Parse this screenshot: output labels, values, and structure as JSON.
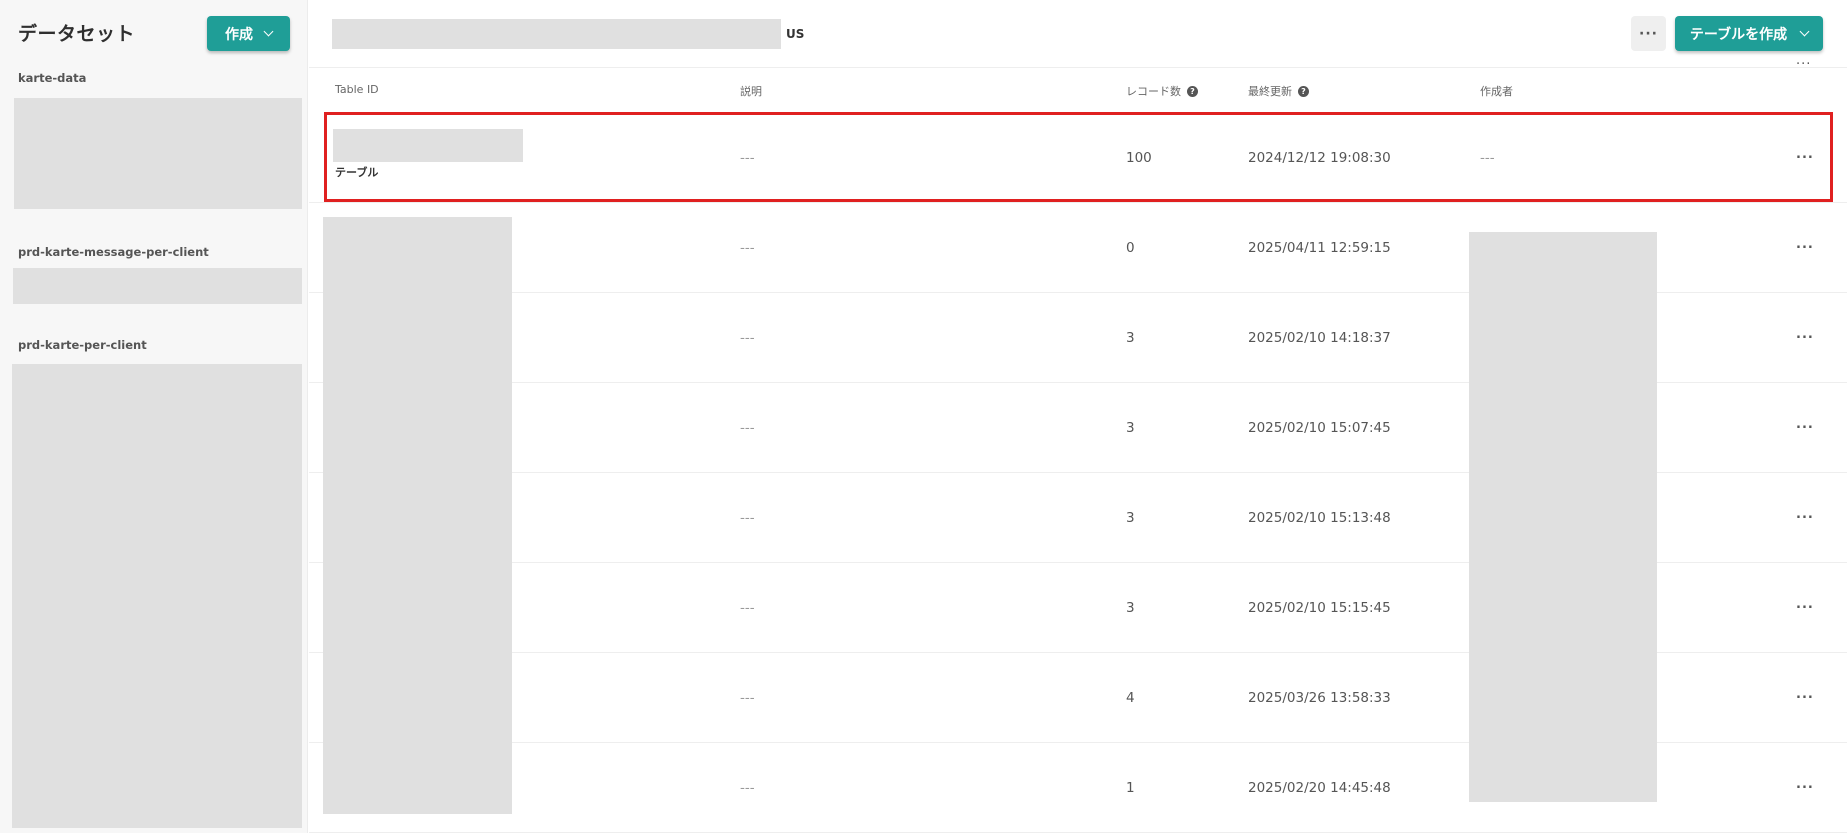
{
  "sidebar": {
    "title": "データセット",
    "create_label": "作成",
    "datasets": [
      "karte-data",
      "prd-karte-message-per-client",
      "prd-karte-per-client"
    ]
  },
  "topbar": {
    "region": "US",
    "more_label": "···",
    "create_table_label": "テーブルを作成"
  },
  "table": {
    "headers": {
      "table_id": "Table ID",
      "description": "説明",
      "record_count": "レコード数",
      "last_updated": "最終更新",
      "creator": "作成者"
    },
    "rows": [
      {
        "name": "テーブル",
        "description": "---",
        "count": "100",
        "updated": "2024/12/12 19:08:30",
        "creator": "---"
      },
      {
        "name": "",
        "description": "---",
        "count": "0",
        "updated": "2025/04/11 12:59:15",
        "creator": ""
      },
      {
        "name": "",
        "description": "---",
        "count": "3",
        "updated": "2025/02/10 14:18:37",
        "creator": ""
      },
      {
        "name": "",
        "description": "---",
        "count": "3",
        "updated": "2025/02/10 15:07:45",
        "creator": ""
      },
      {
        "name": "",
        "description": "---",
        "count": "3",
        "updated": "2025/02/10 15:13:48",
        "creator": ""
      },
      {
        "name": "",
        "description": "---",
        "count": "3",
        "updated": "2025/02/10 15:15:45",
        "creator": ""
      },
      {
        "name": "",
        "description": "---",
        "count": "4",
        "updated": "2025/03/26 13:58:33",
        "creator": ""
      },
      {
        "name": "",
        "description": "---",
        "count": "1",
        "updated": "2025/02/20 14:45:48",
        "creator": ""
      }
    ],
    "row_menu_label": "···"
  },
  "colors": {
    "accent": "#1f9e97",
    "highlight": "#e02020",
    "placeholder": "#e0e0e0"
  }
}
